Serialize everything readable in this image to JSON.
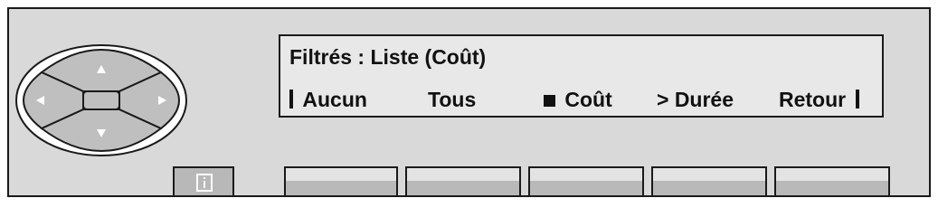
{
  "display": {
    "title": "Filtrés : Liste (Coût)",
    "options": {
      "aucun": "Aucun",
      "tous": "Tous",
      "cout": "Coût",
      "duree": "> Durée",
      "retour": "Retour"
    }
  },
  "icons": {
    "nav_up": "arrow-up-icon",
    "nav_down": "arrow-down-icon",
    "nav_left": "arrow-left-icon",
    "nav_right": "arrow-right-icon",
    "info": "info-icon"
  },
  "colors": {
    "panel": "#d9d9d9",
    "screen": "#e8e8e8",
    "key_top": "#e3e3e3",
    "key_bottom": "#b9b9b9",
    "nav_button": "#bfbfbf",
    "outline": "#1a1a1a"
  }
}
